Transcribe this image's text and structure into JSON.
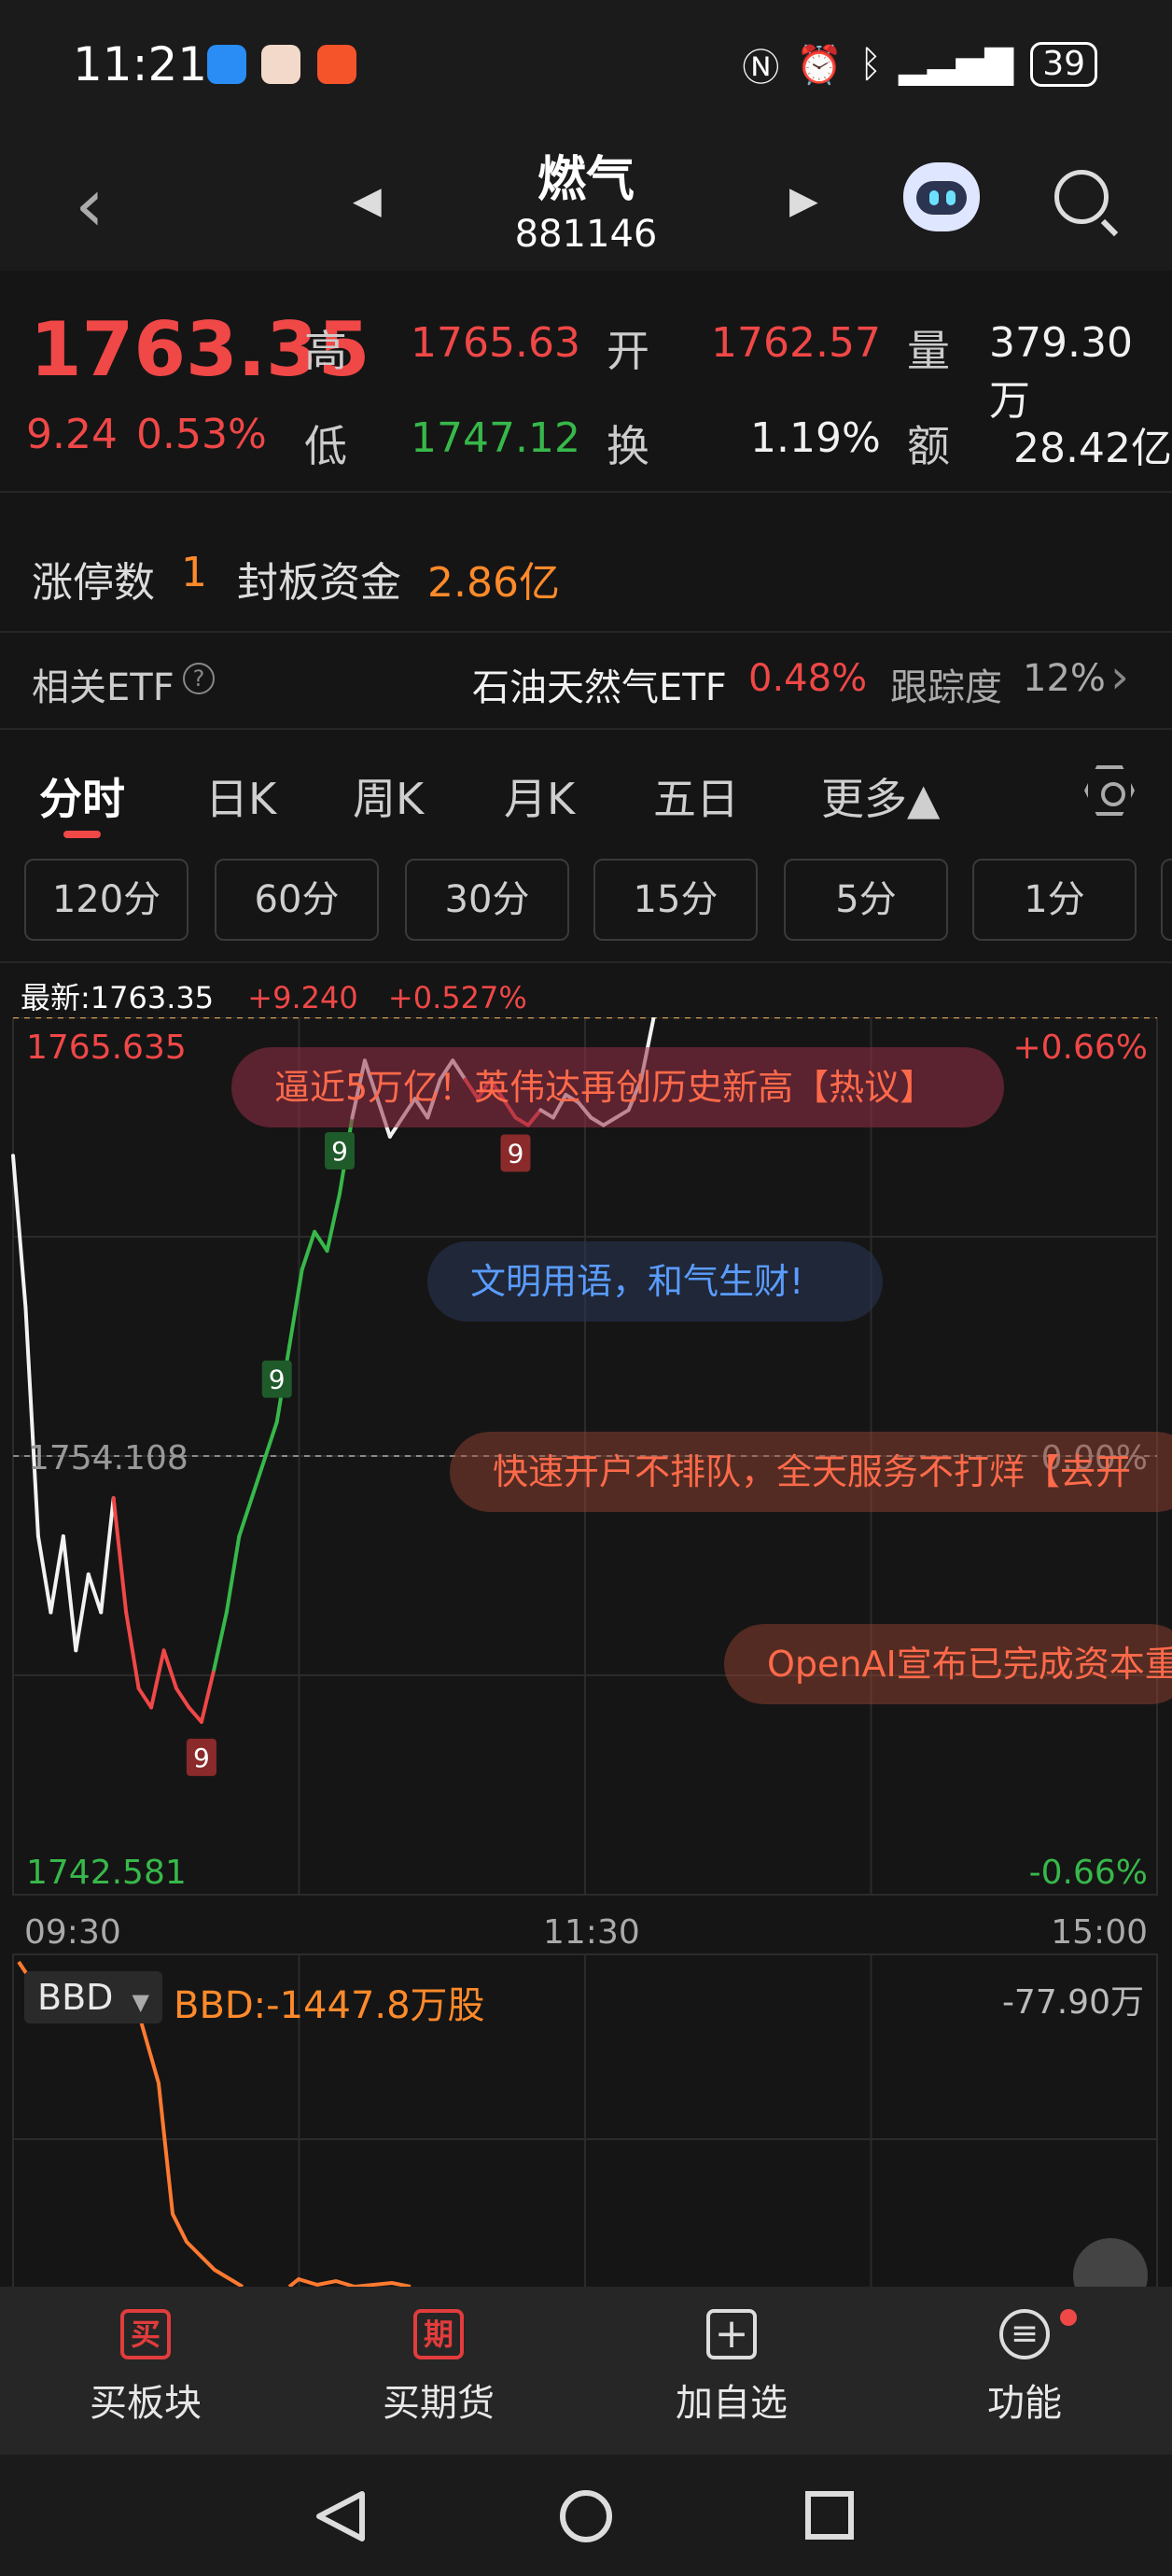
{
  "status_bar": {
    "time": "11:21",
    "icons": [
      "nfc-icon",
      "alarm-icon",
      "bluetooth-icon",
      "signal-icon"
    ],
    "battery": "39"
  },
  "header": {
    "title": "燃气",
    "code": "881146"
  },
  "quote": {
    "price": "1763.35",
    "change": "9.24",
    "change_pct": "0.53%",
    "high_label": "高",
    "high": "1765.63",
    "open_label": "开",
    "open": "1762.57",
    "volume_label": "量",
    "volume": "379.30万",
    "low_label": "低",
    "low": "1747.12",
    "turnover_label": "换",
    "turnover": "1.19%",
    "amount_label": "额",
    "amount": "28.42亿"
  },
  "limit": {
    "count_label": "涨停数",
    "count": "1",
    "fund_label": "封板资金",
    "fund": "2.86亿"
  },
  "etf": {
    "label": "相关ETF",
    "name": "石油天然气ETF",
    "pct": "0.48%",
    "track_label": "跟踪度",
    "track": "12%"
  },
  "tabs": [
    "分时",
    "日K",
    "周K",
    "月K",
    "五日",
    "更多▲"
  ],
  "periods": [
    "120分",
    "60分",
    "30分",
    "15分",
    "5分",
    "1分"
  ],
  "chart_info": {
    "latest": "最新:1763.35",
    "change": "+9.240",
    "change_pct": "+0.527%"
  },
  "chart_data": {
    "type": "line",
    "y_max_label": "1765.635",
    "y_mid_label": "1754.108",
    "y_min_label": "1742.581",
    "pct_max_label": "+0.66%",
    "pct_mid_label": "0.00%",
    "pct_min_label": "-0.66%",
    "x_labels": [
      "09:30",
      "11:30",
      "15:00"
    ],
    "ylim": [
      1742.581,
      1765.635
    ],
    "prev_close": 1754.108,
    "values": [
      1762,
      1758,
      1752,
      1750,
      1752,
      1749,
      1751,
      1750,
      1753,
      1750,
      1748,
      1747.5,
      1749,
      1748,
      1747.5,
      1747.12,
      1748.5,
      1750,
      1752,
      1753,
      1754,
      1755,
      1757,
      1759,
      1760,
      1759.5,
      1761,
      1763,
      1764.5,
      1763.5,
      1762.5,
      1763,
      1763.5,
      1763,
      1764,
      1764.5,
      1764,
      1763.5,
      1764,
      1763.5,
      1763,
      1762.8,
      1763.2,
      1763,
      1763.6,
      1763.4,
      1763,
      1762.8,
      1763,
      1763.2,
      1764,
      1765.63
    ],
    "signals": [
      "9",
      "9",
      "9",
      "9"
    ]
  },
  "banners": [
    "逼近5万亿！英伟达再创历史新高【热议】",
    "文明用语，和气生财!",
    "快速开户不排队，全天服务不打烊【去开",
    "OpenAI宣布已完成资本重"
  ],
  "bbd": {
    "selector": "BBD",
    "label": "BBD:-1447.8万股",
    "top_value": "-77.90万"
  },
  "toolbar": {
    "items": [
      {
        "icon_text": "买",
        "label": "买板块"
      },
      {
        "icon_text": "期",
        "label": "买期货"
      },
      {
        "icon_text": "+",
        "label": "加自选"
      },
      {
        "icon_text": "≡",
        "label": "功能"
      }
    ]
  },
  "colors": {
    "up": "#f04747",
    "down": "#37b84a",
    "price_line": "#f2f2f2",
    "bbd_line": "#ff7a30"
  }
}
